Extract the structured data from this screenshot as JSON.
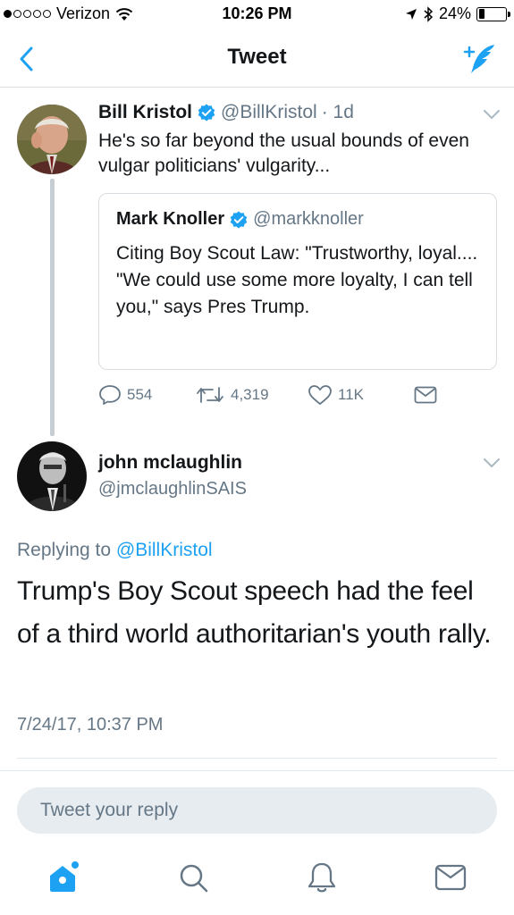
{
  "status_bar": {
    "carrier": "Verizon",
    "time": "10:26 PM",
    "battery": "24%",
    "battery_level": 0.24
  },
  "nav": {
    "title": "Tweet"
  },
  "tweet1": {
    "name": "Bill Kristol",
    "handle": "@BillKristol",
    "time": "· 1d",
    "text": "He's so far beyond the usual bounds of even vulgar politicians' vulgarity...",
    "quote": {
      "name": "Mark Knoller",
      "handle": "@markknoller",
      "text": "Citing Boy Scout Law: \"Trustworthy, loyal.... \"We could use some more loyalty, I can tell you,\" says Pres Trump."
    },
    "actions": {
      "replies": "554",
      "retweets": "4,319",
      "likes": "11K"
    }
  },
  "tweet2": {
    "name": "john mclaughlin",
    "handle": "@jmclaughlinSAIS",
    "replying_prefix": "Replying to",
    "replying_to": "@BillKristol",
    "text": "Trump's Boy Scout speech had the feel of a third world authoritarian's youth rally.",
    "timestamp": "7/24/17, 10:37 PM"
  },
  "reply_box": {
    "placeholder": "Tweet your reply"
  },
  "colors": {
    "accent": "#1da1f2",
    "secondary_text": "#657786",
    "primary_text": "#14171a",
    "divider": "#e1e8ed"
  },
  "icons": {
    "nav": [
      "back-chevron-icon",
      "compose-tweet-icon"
    ],
    "actions": [
      "reply-icon",
      "retweet-icon",
      "like-icon",
      "direct-message-icon"
    ],
    "tabs": [
      "home-icon",
      "search-icon",
      "notifications-icon",
      "messages-icon"
    ]
  }
}
